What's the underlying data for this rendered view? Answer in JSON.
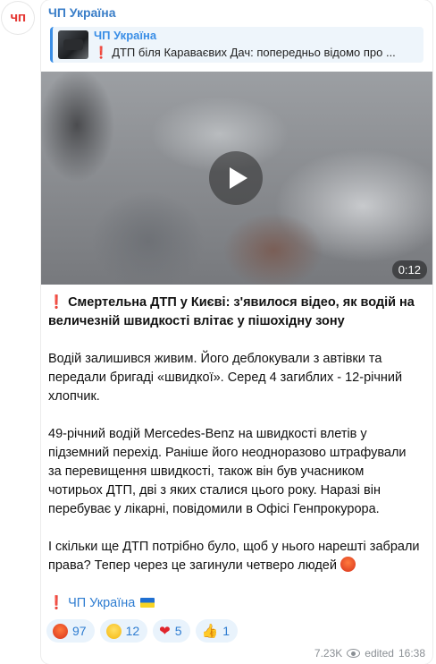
{
  "channel": {
    "avatar_text": "ЧП",
    "name": "ЧП Україна"
  },
  "reply": {
    "name": "ЧП Україна",
    "text": "ДТП біля Караваєвих Дач: попередньо відомо про ..."
  },
  "video": {
    "duration": "0:12"
  },
  "post": {
    "headline": "Смертельна ДТП у Києві: з'явилося відео, як водій на величезній швидкості влітає у пішохідну зону",
    "p1": "Водій залишився живим. Його деблокували з автівки та передали бригаді «швидкої». Серед 4 загиблих - 12-річний хлопчик.",
    "p2": "49-річний водій Mercedes-Benz на швидкості влетів у підземний перехід. Раніше його неодноразово штрафували за перевищення швидкості, також він був учасником чотирьох ДТП, дві з яких сталися цього року. Наразі він перебуває у лікарні, повідомили в Офісі Генпрокурора.",
    "p3": "І скільки ще ДТП потрібно було, щоб у нього нарешті забрали права? Тепер через це загинули четверо людей",
    "signature": "ЧП Україна"
  },
  "reactions": [
    {
      "icon": "angry-face-icon",
      "count": "97"
    },
    {
      "icon": "sad-face-icon",
      "count": "12"
    },
    {
      "icon": "heart-icon",
      "count": "5"
    },
    {
      "icon": "thumbs-up-icon",
      "count": "1"
    }
  ],
  "meta": {
    "views": "7.23K",
    "edited": "edited",
    "time": "16:38"
  }
}
